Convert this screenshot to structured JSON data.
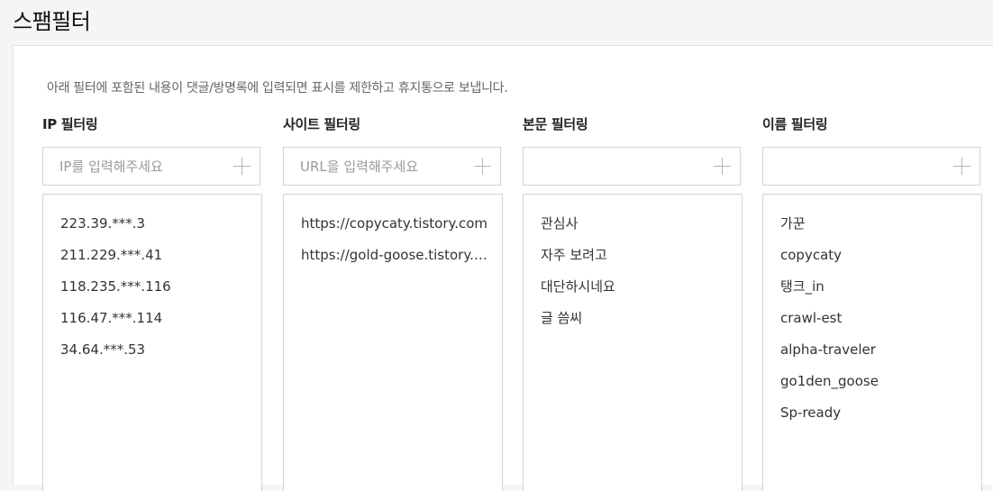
{
  "page": {
    "title": "스팸필터",
    "description": "아래 필터에 포함된 내용이 댓글/방명록에 입력되면 표시를 제한하고 휴지통으로 보냅니다."
  },
  "columns": [
    {
      "title": "IP 필터링",
      "placeholder": "IP를 입력해주세요",
      "items": [
        "223.39.***.3",
        "211.229.***.41",
        "118.235.***.116",
        "116.47.***.114",
        "34.64.***.53"
      ]
    },
    {
      "title": "사이트 필터링",
      "placeholder": "URL을 입력해주세요",
      "items": [
        "https://copycaty.tistory.com",
        "https://gold-goose.tistory.com"
      ]
    },
    {
      "title": "본문 필터링",
      "placeholder": "",
      "items": [
        "관심사",
        "자주 보려고",
        "대단하시네요",
        "글 씀씨"
      ]
    },
    {
      "title": "이름 필터링",
      "placeholder": "",
      "items": [
        "가꾼",
        "copycaty",
        "탱크_in",
        "crawl-est",
        "alpha-traveler",
        "go1den_goose",
        "Sp-ready"
      ]
    }
  ],
  "icons": {
    "add": "plus-icon"
  }
}
